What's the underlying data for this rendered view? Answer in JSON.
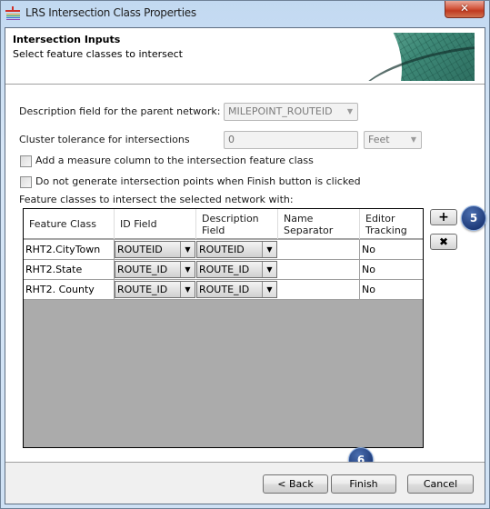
{
  "window": {
    "title": "LRS Intersection Class Properties",
    "app_icon": "lrs-app-icon",
    "close_label": "✕"
  },
  "header": {
    "title": "Intersection Inputs",
    "subtitle": "Select feature classes to intersect"
  },
  "form": {
    "description_field_label": "Description field for the parent network:",
    "description_field_value": "MILEPOINT_ROUTEID",
    "cluster_tolerance_label": "Cluster tolerance for intersections",
    "cluster_tolerance_value": "0",
    "cluster_tolerance_units": "Feet",
    "add_measure_label": "Add a measure column to the intersection feature class",
    "add_measure_checked": false,
    "no_generate_label": "Do not generate intersection points when Finish button is clicked",
    "no_generate_checked": false,
    "grid_label": "Feature classes to intersect the selected network with:"
  },
  "grid": {
    "columns": [
      "Feature Class",
      "ID Field",
      "Description Field",
      "Name Separator",
      "Editor Tracking"
    ],
    "column_lines": {
      "description": [
        "Description",
        "Field"
      ],
      "separator": [
        "Name",
        "Separator"
      ],
      "editor": [
        "Editor",
        "Tracking"
      ]
    },
    "rows": [
      {
        "feature_class": "RHT2.CityTown",
        "id_field": "ROUTEID",
        "description_field": "ROUTEID",
        "name_separator": "",
        "editor_tracking": "No"
      },
      {
        "feature_class": "RHT2.State",
        "id_field": "ROUTE_ID",
        "description_field": "ROUTE_ID",
        "name_separator": "",
        "editor_tracking": "No"
      },
      {
        "feature_class": "RHT2. County",
        "id_field": "ROUTE_ID",
        "description_field": "ROUTE_ID",
        "name_separator": "",
        "editor_tracking": "No"
      }
    ]
  },
  "side_buttons": {
    "add": "+",
    "remove": "✖"
  },
  "callouts": {
    "add_step": "5",
    "finish_step": "6"
  },
  "footer": {
    "back": "< Back",
    "finish": "Finish",
    "cancel": "Cancel"
  },
  "icons": {
    "dropdown": "▼"
  },
  "colors": {
    "callout": "#1f3c7a",
    "grid_background": "#ababab",
    "close_button": "#c03a20"
  }
}
